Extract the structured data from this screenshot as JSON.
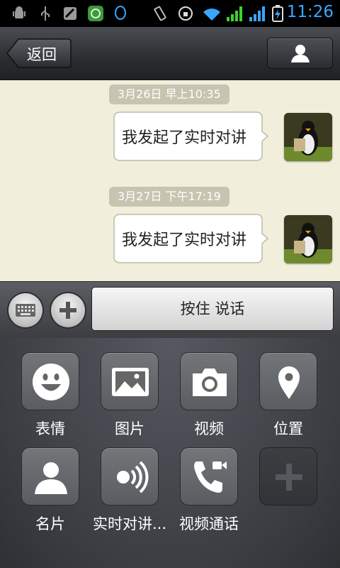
{
  "status_bar": {
    "time": "11:26",
    "time_color": "#3aa6ff",
    "signal_color": "#3cd32a"
  },
  "header": {
    "back_label": "返回",
    "contact_icon": "person-icon"
  },
  "messages": [
    {
      "timestamp": "3月26日 早上10:35",
      "text": "我发起了实时对讲"
    },
    {
      "timestamp": "3月27日 下午17:19",
      "text": "我发起了实时对讲"
    }
  ],
  "input_bar": {
    "hold_to_talk_label": "按住 说话"
  },
  "panel": {
    "items": [
      {
        "label": "表情",
        "icon": "smiley-icon"
      },
      {
        "label": "图片",
        "icon": "image-icon"
      },
      {
        "label": "视频",
        "icon": "camera-icon"
      },
      {
        "label": "位置",
        "icon": "location-pin-icon"
      },
      {
        "label": "名片",
        "icon": "contact-card-icon"
      },
      {
        "label": "实时对讲...",
        "icon": "walkie-talkie-icon"
      },
      {
        "label": "视频通话",
        "icon": "video-call-icon"
      },
      {
        "label": "",
        "icon": "add-icon"
      }
    ]
  },
  "colors": {
    "chat_background": "#f1efdc",
    "timestamp_pill": "#c7c4b0"
  }
}
